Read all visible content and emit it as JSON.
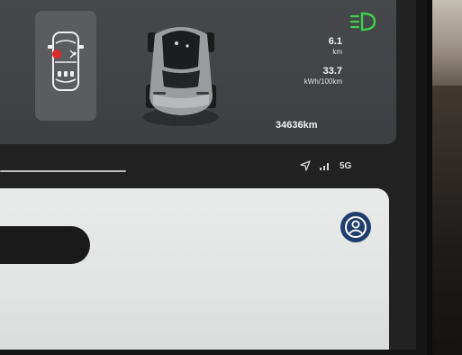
{
  "trip": {
    "distance_value": "6.1",
    "distance_unit": "km",
    "consumption_value": "33.7",
    "consumption_unit": "kWh/100km"
  },
  "odometer": "34636km",
  "status_bar": {
    "network": "5G"
  },
  "icons": {
    "headlight": "headlight-on-icon",
    "doors": "car-doors-icon",
    "navigation": "navigation-arrow-icon",
    "signal": "signal-strength-icon",
    "profile": "profile-icon"
  },
  "colors": {
    "headlight_green": "#3fd14a",
    "door_alert_red": "#e0262b",
    "profile_blue": "#1f3e6e"
  }
}
